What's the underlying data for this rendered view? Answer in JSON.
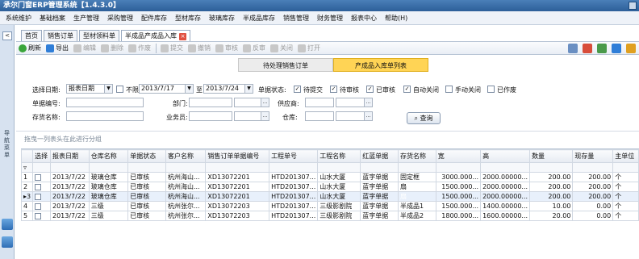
{
  "window": {
    "title": "承尔门窗ERP管理系统【1.4.3.0】"
  },
  "menu": [
    "系统维护",
    "基础档案",
    "生产管理",
    "采购管理",
    "配件库存",
    "型材库存",
    "玻璃库存",
    "半成品库存",
    "销售管理",
    "财务管理",
    "报表中心",
    "帮助(H)"
  ],
  "sidebar": {
    "collapse": "<",
    "label": "导航菜单"
  },
  "tabs": [
    "首页",
    "销售订单",
    "型材领料单",
    "半成品产成品入库"
  ],
  "toolbar": [
    "刷新",
    "导出",
    "编辑",
    "删除",
    "作废",
    "提交",
    "撤销",
    "审核",
    "反审",
    "关闭",
    "打开"
  ],
  "view_tabs": [
    "待处理销售订单",
    "产成品入库单列表"
  ],
  "filters": {
    "date_label": "选择日期:",
    "date_type": "报表日期",
    "no_limit": "不限",
    "date_from": "2013/7/17",
    "to": "至",
    "date_to": "2013/7/24",
    "doc_no_label": "单据编号:",
    "dept_label": "部门:",
    "supplier_label": "供应商:",
    "item_label": "存货名称:",
    "salesman_label": "业务员:",
    "warehouse_label": "仓库:",
    "status_label": "单据状态:",
    "statuses": [
      {
        "label": "待提交",
        "checked": true
      },
      {
        "label": "待审核",
        "checked": true
      },
      {
        "label": "已审核",
        "checked": true
      },
      {
        "label": "自动关闭",
        "checked": true
      },
      {
        "label": "手动关闭",
        "checked": false
      },
      {
        "label": "已作废",
        "checked": false
      }
    ],
    "query_button": "查询"
  },
  "group_hint": "拖曳一列表头在此进行分组",
  "grid": {
    "columns": [
      "选择",
      "报表日期",
      "仓库名称",
      "单据状态",
      "客户名称",
      "销售订单单据编号",
      "工程单号",
      "工程名称",
      "红蓝单据",
      "存货名称",
      "宽",
      "高",
      "数量",
      "现存量",
      "主单位"
    ],
    "rows": [
      {
        "idx": "1",
        "cells": [
          "",
          "2013/7/22",
          "玻璃仓库",
          "已审核",
          "杭州海山...",
          "XD13072201",
          "HTD201307...",
          "山水大厦",
          "蓝字单据",
          "固定框",
          "3000.000...",
          "2000.00000...",
          "200.00",
          "200.00",
          "个"
        ]
      },
      {
        "idx": "2",
        "cells": [
          "",
          "2013/7/22",
          "玻璃仓库",
          "已审核",
          "杭州海山...",
          "XD13072201",
          "HTD201307...",
          "山水大厦",
          "蓝字单据",
          "扇",
          "1500.000...",
          "2000.00000...",
          "200.00",
          "200.00",
          "个"
        ]
      },
      {
        "idx": "3",
        "cells": [
          "",
          "2013/7/22",
          "玻璃仓库",
          "已审核",
          "杭州海山...",
          "XD13072201",
          "HTD201307...",
          "山水大厦",
          "蓝字单据",
          "扇",
          "1500.000...",
          "2000.00000...",
          "200.00",
          "200.00",
          "个"
        ]
      },
      {
        "idx": "4",
        "cells": [
          "",
          "2013/7/22",
          "三级",
          "已审核",
          "杭州张尔...",
          "XD13072203",
          "HTD201307...",
          "三级影剧院",
          "蓝字单据",
          "半成品1",
          "1500.000...",
          "1400.00000...",
          "10.00",
          "0.00",
          "个"
        ]
      },
      {
        "idx": "5",
        "cells": [
          "",
          "2013/7/22",
          "三级",
          "已审核",
          "杭州张尔...",
          "XD13072203",
          "HTD201307...",
          "三级影剧院",
          "蓝字单据",
          "半成品2",
          "1800.000...",
          "1600.00000...",
          "20.00",
          "0.00",
          "个"
        ]
      }
    ],
    "selected_row_marker": "▸3"
  },
  "colors": {
    "accent": "#2d5f99",
    "tab_active": "#ffd455",
    "highlight": "#3b7bd8"
  }
}
